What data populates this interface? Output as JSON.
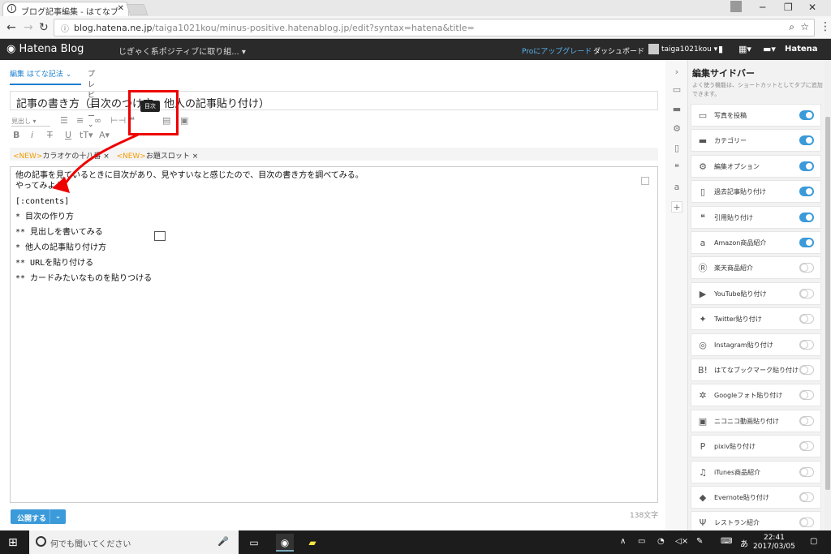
{
  "browser": {
    "tab_title": "ブログ記事編集 - はてなブ",
    "address_host": "blog.hatena.ne.jp",
    "address_path": "/taiga1021kou/minus-positive.hatenablog.jp/edit?syntax=hatena&title="
  },
  "header": {
    "logo": "Hatena Blog",
    "blog_name": "じぎゃく系ポジティブに取り組...",
    "pro_link": "Proにアップグレード",
    "dashboard": "ダッシュボード",
    "user": "taiga1021kou",
    "brand": "Hatena"
  },
  "editor": {
    "tab_edit": "編集 はてな記法",
    "tab_preview": "プレビュー",
    "title": "記事の書き方（目次のつけ方、他人の記事貼り付け）",
    "tooltip": "目次",
    "heading_select": "見出し",
    "notice1_new": "<NEW>",
    "notice1_text": "カラオケの十八番",
    "notice2_new": "<NEW>",
    "notice2_text": "お題スロット",
    "lines": [
      "他の記事を見ているときに目次があり、見やすいなと感じたので、目次の書き方を調べてみる。",
      "やってみよう。",
      "",
      "[:contents]",
      "",
      "* 目次の作り方",
      "",
      "** 見出しを書いてみる",
      "",
      "* 他人の記事貼り付け方",
      "",
      "** URLを貼り付ける",
      "",
      "** カードみたいなものを貼りつける"
    ],
    "publish": "公開する",
    "char_count": "138文字"
  },
  "sidebar": {
    "title": "編集サイドバー",
    "description": "よく使う機能は、ショートカットとしてタブに追加できます。",
    "items": [
      {
        "label": "写真を投稿",
        "icon": "photo-icon",
        "on": true
      },
      {
        "label": "カテゴリー",
        "icon": "folder-icon",
        "on": true
      },
      {
        "label": "編集オプション",
        "icon": "gear-icon",
        "on": true
      },
      {
        "label": "過去記事貼り付け",
        "icon": "document-icon",
        "on": true
      },
      {
        "label": "引用貼り付け",
        "icon": "quote-icon",
        "on": true
      },
      {
        "label": "Amazon商品紹介",
        "icon": "amazon-icon",
        "on": true
      },
      {
        "label": "楽天商品紹介",
        "icon": "rakuten-icon",
        "on": false
      },
      {
        "label": "YouTube貼り付け",
        "icon": "youtube-icon",
        "on": false
      },
      {
        "label": "Twitter貼り付け",
        "icon": "twitter-icon",
        "on": false
      },
      {
        "label": "Instagram貼り付け",
        "icon": "instagram-icon",
        "on": false
      },
      {
        "label": "はてなブックマーク貼り付け",
        "icon": "hatebu-icon",
        "on": false
      },
      {
        "label": "Googleフォト貼り付け",
        "icon": "google-photos-icon",
        "on": false
      },
      {
        "label": "ニコニコ動画貼り付け",
        "icon": "niconico-icon",
        "on": false
      },
      {
        "label": "pixiv貼り付け",
        "icon": "pixiv-icon",
        "on": false
      },
      {
        "label": "iTunes商品紹介",
        "icon": "music-icon",
        "on": false
      },
      {
        "label": "Evernote貼り付け",
        "icon": "evernote-icon",
        "on": false
      },
      {
        "label": "レストラン紹介",
        "icon": "restaurant-icon",
        "on": false
      }
    ]
  },
  "taskbar": {
    "search_placeholder": "何でも聞いてください",
    "time": "22:41",
    "date": "2017/03/05",
    "ime": "あ"
  },
  "colors": {
    "accent": "#3b9ad9",
    "highlight": "#e00000",
    "header_bg": "#2a2a2a"
  }
}
